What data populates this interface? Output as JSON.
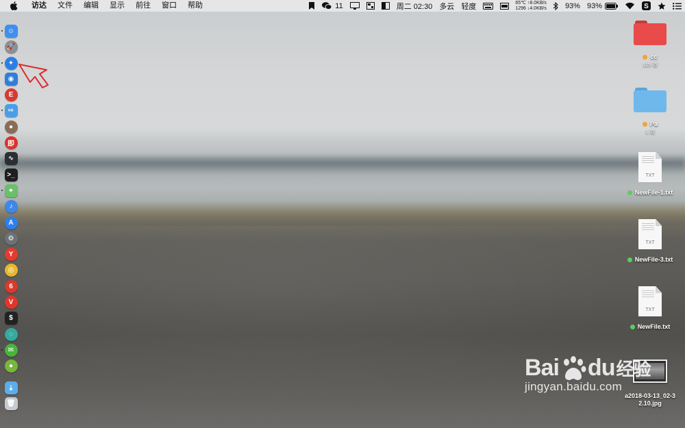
{
  "menubar": {
    "items": [
      "访达",
      "文件",
      "编辑",
      "显示",
      "前往",
      "窗口",
      "帮助"
    ],
    "status": {
      "wechat_count": "11",
      "datetime": "周二 02:30",
      "weather": "多云",
      "air": "轻度",
      "temp": "65℃",
      "upload": "↑8.0KB/s",
      "fan": "1296",
      "download": "↓4.0KB/s",
      "battery1": "93%",
      "battery2": "93%"
    }
  },
  "dock": {
    "apps": [
      {
        "name": "finder",
        "color": "#3f8ff0",
        "glyph": "☺"
      },
      {
        "name": "launchpad",
        "color": "#8b8f96",
        "glyph": "🚀"
      },
      {
        "name": "safari",
        "color": "#2a7fe6",
        "glyph": "✦"
      },
      {
        "name": "preview",
        "color": "#2f7fd8",
        "glyph": "◉"
      },
      {
        "name": "app-red-1",
        "color": "#d73a32",
        "glyph": "E"
      },
      {
        "name": "migration",
        "color": "#4a9ee8",
        "glyph": "⇨"
      },
      {
        "name": "photo-app",
        "color": "#8a6d55",
        "glyph": "●"
      },
      {
        "name": "app-red-2",
        "color": "#d9332b",
        "glyph": "即"
      },
      {
        "name": "activity-monitor",
        "color": "#2b2f33",
        "glyph": "∿"
      },
      {
        "name": "terminal",
        "color": "#1e1e1e",
        "glyph": ">_"
      },
      {
        "name": "maps",
        "color": "#6bbf6b",
        "glyph": "⌖"
      },
      {
        "name": "siri",
        "color": "#3f88e8",
        "glyph": "♪"
      },
      {
        "name": "app-store",
        "color": "#2d7ff0",
        "glyph": "A"
      },
      {
        "name": "system-preferences",
        "color": "#6d7277",
        "glyph": "⚙"
      },
      {
        "name": "yandex",
        "color": "#e53b2f",
        "glyph": "Y"
      },
      {
        "name": "chrome",
        "color": "#e6b830",
        "glyph": "◎"
      },
      {
        "name": "netease-music",
        "color": "#d83a2e",
        "glyph": "6"
      },
      {
        "name": "vivaldi",
        "color": "#e2362b",
        "glyph": "V"
      },
      {
        "name": "terminal-2",
        "color": "#222",
        "glyph": "$"
      },
      {
        "name": "app-teal",
        "color": "#36a9a0",
        "glyph": "◌"
      },
      {
        "name": "wechat",
        "color": "#49b43c",
        "glyph": "✉"
      },
      {
        "name": "android-app",
        "color": "#78b63c",
        "glyph": "●"
      }
    ],
    "pinned": [
      {
        "name": "downloads",
        "color": "#5aaeea",
        "glyph": "⤓"
      },
      {
        "name": "trash",
        "color": "#c7cbcf",
        "glyph": "🗑"
      }
    ]
  },
  "desktop": {
    "items": [
      {
        "type": "folder",
        "label": "cc",
        "sub": "115 项",
        "folder_color": "#e94b4b",
        "tag_color": "#f2a23a"
      },
      {
        "type": "folder",
        "label": "Pa",
        "sub": "1 项",
        "folder_color": "#6fb8ec",
        "tag_color": "#f2a23a"
      },
      {
        "type": "txt",
        "label": "NewFile-1.txt",
        "ext": "TXT",
        "tag_color": "#5ccd5c"
      },
      {
        "type": "txt",
        "label": "NewFile-3.txt",
        "ext": "TXT",
        "tag_color": "#5ccd5c"
      },
      {
        "type": "txt",
        "label": "NewFile.txt",
        "ext": "TXT",
        "tag_color": "#5ccd5c"
      },
      {
        "type": "image",
        "label": "a2018-03-13_02-3",
        "sub": "2.10.jpg"
      }
    ]
  },
  "watermark": {
    "brand": "Bai",
    "brand2": "du",
    "brand_cn": "经验",
    "url": "jingyan.baidu.com"
  }
}
